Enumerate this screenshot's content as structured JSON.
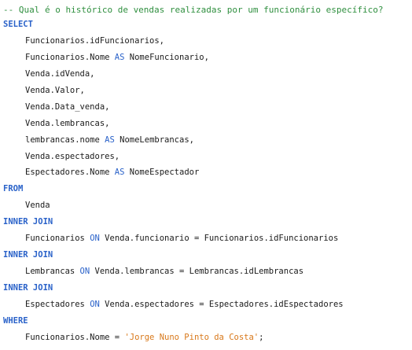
{
  "editor": {
    "colors": {
      "comment": "#2f8f3f",
      "keyword": "#2a62c9",
      "string": "#d8781a",
      "text": "#1a1a1a",
      "background": "#ffffff"
    },
    "comment": "-- Qual é o histórico de vendas realizadas por um funcionário específico?",
    "select_kw": "SELECT",
    "select_items": [
      "Funcionarios.idFuncionarios,",
      "Funcionarios.Nome",
      "Venda.idVenda,",
      "Venda.Valor,",
      "Venda.Data_venda,",
      "Venda.lembrancas,",
      "lembrancas.nome",
      "Venda.espectadores,",
      "Espectadores.Nome"
    ],
    "as_kw": "AS",
    "aliases": {
      "nome_funcionario": "NomeFuncionario,",
      "nome_lembrancas": "NomeLembrancas,",
      "nome_espectador": "NomeEspectador"
    },
    "from_kw": "FROM",
    "from_table": "Venda",
    "join_kw": "INNER JOIN",
    "on_kw": "ON",
    "joins": [
      {
        "table": "Funcionarios",
        "condition": "Venda.funcionario = Funcionarios.idFuncionarios"
      },
      {
        "table": "Lembrancas",
        "condition": "Venda.lembrancas = Lembrancas.idLembrancas"
      },
      {
        "table": "Espectadores",
        "condition": "Venda.espectadores = Espectadores.idEspectadores"
      }
    ],
    "where_kw": "WHERE",
    "where_lhs": "Funcionarios.Nome =",
    "where_value": "'Jorge Nuno Pinto da Costa'",
    "where_end": ";"
  }
}
